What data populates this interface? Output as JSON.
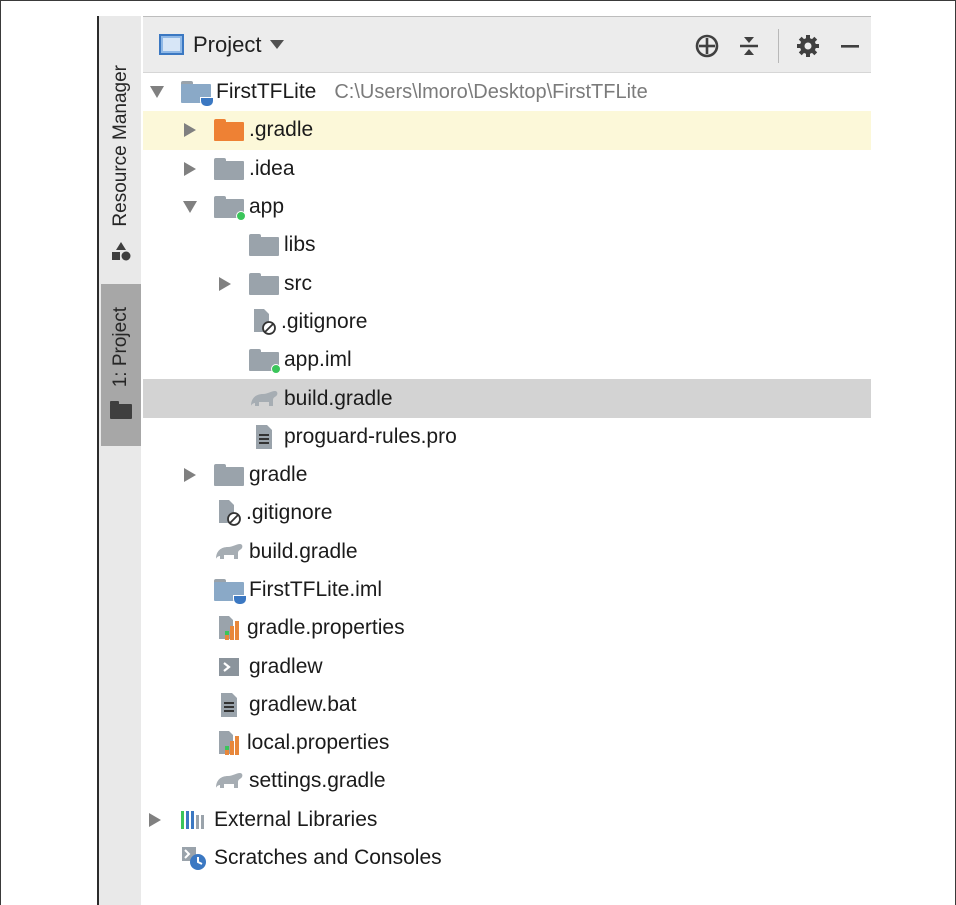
{
  "sidebar": {
    "resource_manager": "Resource Manager",
    "project_tab": "1: Project"
  },
  "header": {
    "title": "Project",
    "icons": [
      "crosshair-icon",
      "collapse-all-icon",
      "gear-icon",
      "minimize-icon"
    ]
  },
  "tree": {
    "root": {
      "label": "FirstTFLite",
      "path": "C:\\Users\\lmoro\\Desktop\\FirstTFLite"
    },
    "items": [
      {
        "label": ".gradle",
        "icon": "folder-orange"
      },
      {
        "label": ".idea",
        "icon": "folder"
      },
      {
        "label": "app",
        "icon": "module-folder"
      },
      {
        "label": "libs",
        "icon": "folder"
      },
      {
        "label": "src",
        "icon": "folder"
      },
      {
        "label": ".gitignore",
        "icon": "ignore-file"
      },
      {
        "label": "app.iml",
        "icon": "module-file"
      },
      {
        "label": "build.gradle",
        "icon": "gradle-elephant"
      },
      {
        "label": "proguard-rules.pro",
        "icon": "text-file"
      },
      {
        "label": "gradle",
        "icon": "folder"
      },
      {
        "label": ".gitignore",
        "icon": "ignore-file"
      },
      {
        "label": "build.gradle",
        "icon": "gradle-elephant"
      },
      {
        "label": "FirstTFLite.iml",
        "icon": "project-file"
      },
      {
        "label": "gradle.properties",
        "icon": "properties-file"
      },
      {
        "label": "gradlew",
        "icon": "shell-script"
      },
      {
        "label": "gradlew.bat",
        "icon": "text-file"
      },
      {
        "label": "local.properties",
        "icon": "properties-file"
      },
      {
        "label": "settings.gradle",
        "icon": "gradle-elephant"
      },
      {
        "label": "External Libraries",
        "icon": "libraries"
      },
      {
        "label": "Scratches and Consoles",
        "icon": "scratches"
      }
    ]
  },
  "colors": {
    "highlight_yellow": "#fcf8d9",
    "selection_gray": "#d3d3d3",
    "path_gray": "#7b7b7b",
    "folder_gray": "#9aa3ab",
    "folder_orange": "#ee8134",
    "module_green": "#3ac55a",
    "project_blue": "#3b78c2"
  }
}
